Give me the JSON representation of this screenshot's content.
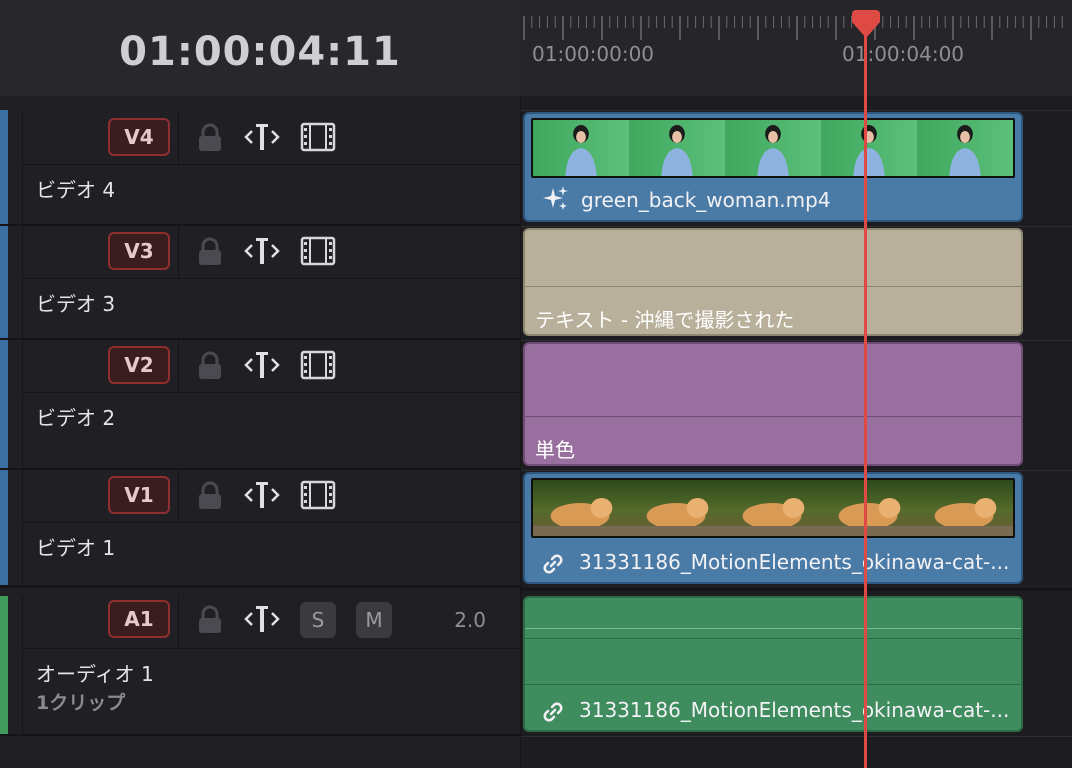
{
  "header": {
    "timecode": "01:00:04:11"
  },
  "ruler": {
    "labels": [
      "01:00:00:00",
      "01:00:04:00"
    ]
  },
  "tracks": [
    {
      "id": "V4",
      "name": "ビデオ 4",
      "strip_color": "#3b6fa0"
    },
    {
      "id": "V3",
      "name": "ビデオ 3",
      "strip_color": "#3b6fa0"
    },
    {
      "id": "V2",
      "name": "ビデオ 2",
      "strip_color": "#3b6fa0"
    },
    {
      "id": "V1",
      "name": "ビデオ 1",
      "strip_color": "#3b6fa0"
    },
    {
      "id": "A1",
      "name": "オーディオ 1",
      "sub": "1クリップ",
      "solo_label": "S",
      "mute_label": "M",
      "channels": "2.0",
      "strip_color": "#3f9a5c"
    }
  ],
  "clips": {
    "v4": {
      "label": "green_back_woman.mp4",
      "color": "#4a7aa6",
      "icon": "sparkle-icon"
    },
    "v3": {
      "label": "テキスト - 沖縄で撮影された",
      "color": "#b8b09a"
    },
    "v2": {
      "label": "単色",
      "color": "#986f9e"
    },
    "v1": {
      "label": "31331186_MotionElements_okinawa-cat-...",
      "color": "#4a7aa6",
      "icon": "link-icon"
    },
    "a1": {
      "label": "31331186_MotionElements_okinawa-cat-...",
      "color": "#3f8c5e",
      "icon": "link-icon"
    }
  },
  "icons": {
    "lock": "lock-icon",
    "trim": "trim-icon",
    "film": "film-icon",
    "playhead": "playhead-icon"
  },
  "colors": {
    "playhead": "#e04a44",
    "badge_border": "#8f2e2e"
  }
}
